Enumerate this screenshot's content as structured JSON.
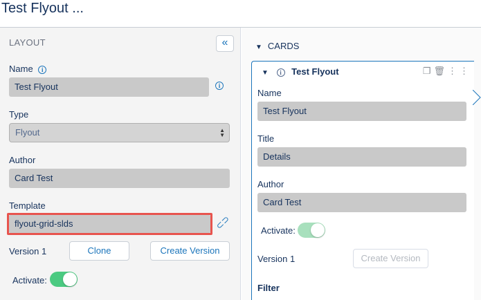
{
  "header": {
    "title": "Test Flyout ..."
  },
  "left": {
    "section_title": "LAYOUT",
    "collapse_icon": "double-chevron-left-icon",
    "name_label": "Name",
    "name_value": "Test Flyout",
    "type_label": "Type",
    "type_value": "Flyout",
    "author_label": "Author",
    "author_value": "Card Test",
    "template_label": "Template",
    "template_value": "flyout-grid-slds",
    "version_label": "Version 1",
    "clone_label": "Clone",
    "create_version_label": "Create Version",
    "activate_label": "Activate:"
  },
  "right": {
    "cards_label": "CARDS",
    "card": {
      "title": "Test Flyout",
      "name_label": "Name",
      "name_value": "Test Flyout",
      "title_label": "Title",
      "title_value": "Details",
      "author_label": "Author",
      "author_value": "Card Test",
      "activate_label": "Activate:",
      "version_label": "Version 1",
      "create_version_label": "Create Version",
      "filter_label": "Filter"
    }
  },
  "colors": {
    "accent": "#1b75bb",
    "toggle_on": "#4bca81",
    "highlight": "#e8544e",
    "field_bg": "#c9c9c9"
  }
}
